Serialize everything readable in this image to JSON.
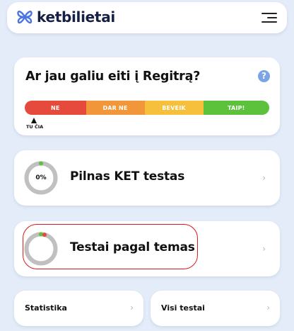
{
  "header": {
    "brand": "ketbilietai",
    "logo_icon": "butterfly-logo-icon",
    "menu_icon": "hamburger-menu-icon"
  },
  "readiness": {
    "title": "Ar jau galiu eiti į Regitrą?",
    "help_icon": "question-icon",
    "help_symbol": "?",
    "levels": [
      {
        "label": "NE",
        "color": "#e64a3c"
      },
      {
        "label": "DAR NE",
        "color": "#f2963a"
      },
      {
        "label": "BEVEIK",
        "color": "#f6c03c"
      },
      {
        "label": "TAIP!",
        "color": "#5cc23c"
      }
    ],
    "marker_label": "TU ČIA",
    "marker_level": 0
  },
  "tests": {
    "full": {
      "title": "Pilnas KET testas",
      "progress_text": "0%",
      "progress": 0,
      "ring_color": "#c0c0c0",
      "accent_color": "#5cc23c"
    },
    "by_topic": {
      "title": "Testai pagal temas",
      "ring_color": "#c0c0c0",
      "accent_colors": [
        "#5cc23c",
        "#e64a3c"
      ]
    }
  },
  "bottom": {
    "statistics_label": "Statistika",
    "all_tests_label": "Visi testai"
  },
  "chevron": "›"
}
